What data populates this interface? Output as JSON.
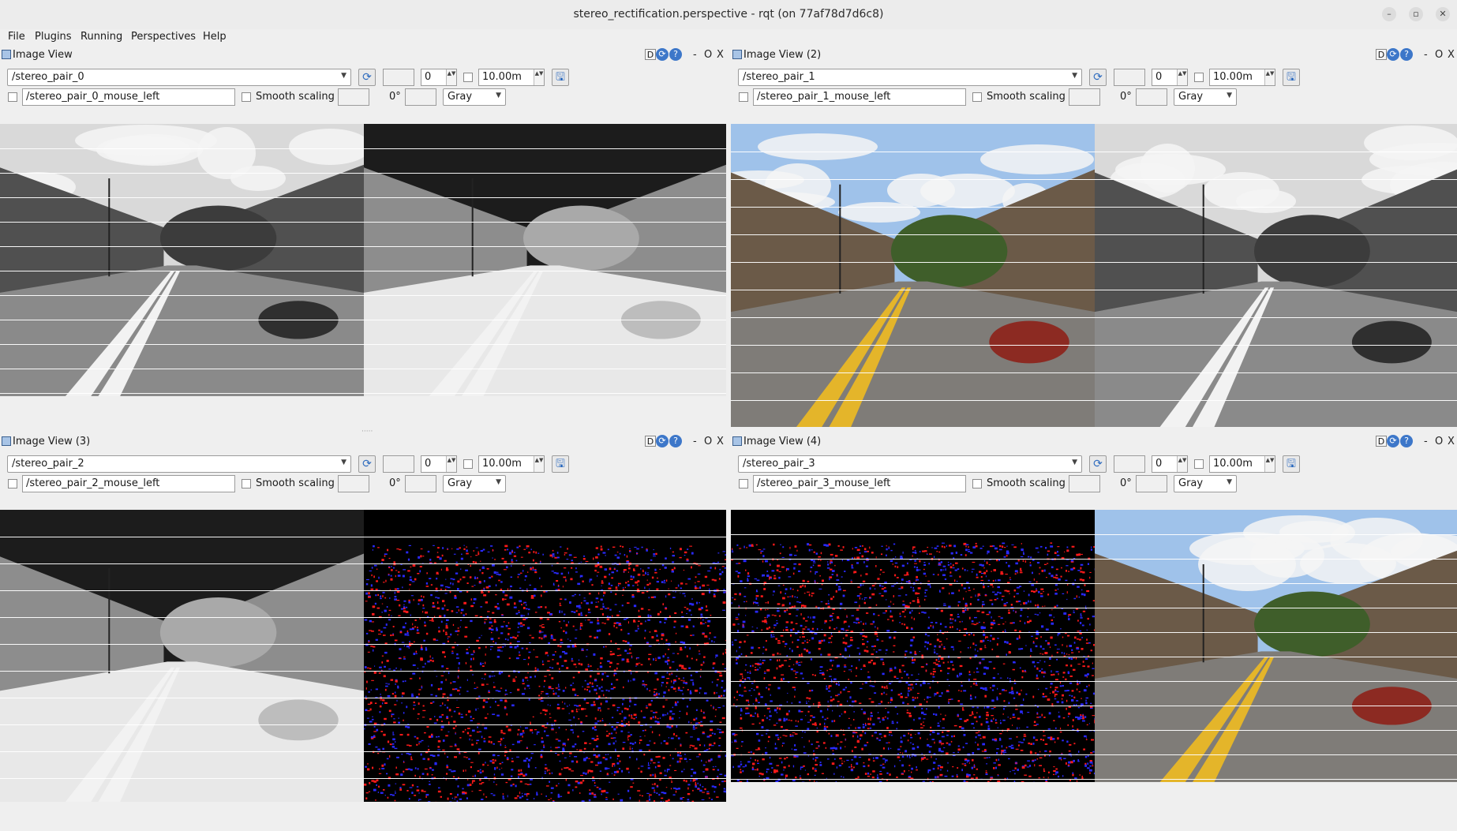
{
  "window": {
    "title": "stereo_rectification.perspective - rqt (on 77af78d7d6c8)",
    "minimize": "–",
    "restore": "▫",
    "close": "✕"
  },
  "menu": [
    "File",
    "Plugins",
    "Running",
    "Perspectives",
    "Help"
  ],
  "common": {
    "d_label": "D",
    "refresh_glyph": "⟳",
    "help_glyph": "?",
    "minus": "-",
    "o": "O",
    "x": "X",
    "num_value": "0",
    "max_range": "10.00m",
    "smooth_label": "Smooth scaling",
    "rotation": "0°",
    "color_scheme": "Gray",
    "save_glyph": "🖫",
    "spin_glyph": "▲▼"
  },
  "panels": [
    {
      "title": "Image View",
      "topic": "/stereo_pair_0",
      "mouse_topic": "/stereo_pair_0_mouse_left",
      "left_kind": "gray",
      "right_kind": "thermal"
    },
    {
      "title": "Image View (2)",
      "topic": "/stereo_pair_1",
      "mouse_topic": "/stereo_pair_1_mouse_left",
      "left_kind": "color",
      "right_kind": "gray"
    },
    {
      "title": "Image View (3)",
      "topic": "/stereo_pair_2",
      "mouse_topic": "/stereo_pair_2_mouse_left",
      "left_kind": "thermal",
      "right_kind": "events"
    },
    {
      "title": "Image View (4)",
      "topic": "/stereo_pair_3",
      "mouse_topic": "/stereo_pair_3_mouse_left",
      "left_kind": "events",
      "right_kind": "color"
    }
  ]
}
